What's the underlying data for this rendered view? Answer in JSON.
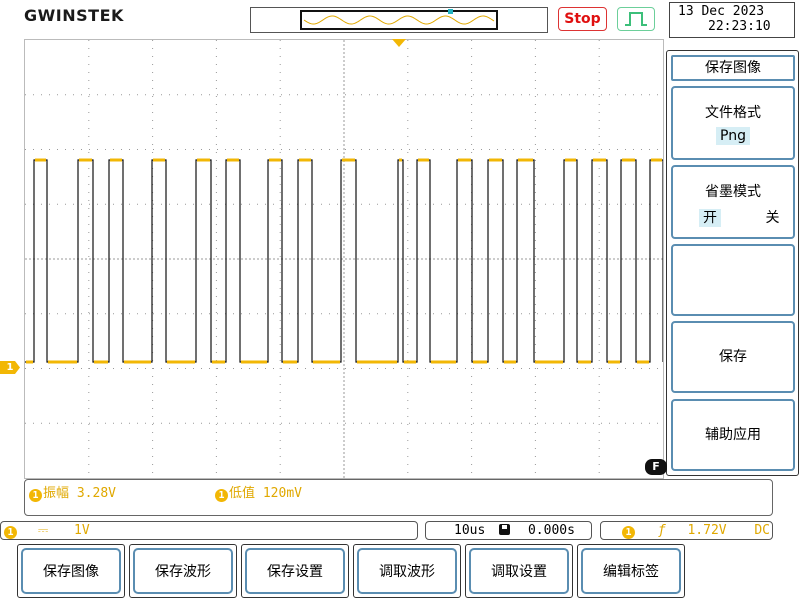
{
  "header": {
    "logo": "GWINSTEK",
    "run_state": "Stop",
    "date": "13 Dec 2023",
    "time": "22:23:10"
  },
  "channel_marker": "1",
  "menu": {
    "title": "保存图像",
    "items": [
      {
        "label": "文件格式",
        "value": "Png"
      },
      {
        "label": "省墨模式",
        "option_on": "开",
        "option_off": "关"
      },
      {
        "label": ""
      },
      {
        "label": "保存"
      },
      {
        "label": "辅助应用"
      }
    ],
    "f_badge": "F"
  },
  "measurements": [
    {
      "channel": "1",
      "name": "振幅",
      "value": "3.28V"
    },
    {
      "channel": "1",
      "name": "低值",
      "value": "120mV"
    }
  ],
  "status": {
    "ch1_scale": "1V",
    "timebase": "10us",
    "position": "0.000s",
    "trigger_channel": "1",
    "trigger_level": "1.72V",
    "coupling": "DC"
  },
  "bottom_buttons": [
    "保存图像",
    "保存波形",
    "保存设置",
    "调取波形",
    "调取设置",
    "编辑标签"
  ],
  "colors": {
    "channel1": "#f2b705",
    "menu_border": "#5a8db1",
    "stop": "#e01010",
    "trigger_icon": "#6ccf9a"
  },
  "icons": [
    "trigger-rising-edge-icon",
    "save-disk-icon",
    "trigger-level-arrow-icon",
    "channel-1-marker-icon"
  ]
}
